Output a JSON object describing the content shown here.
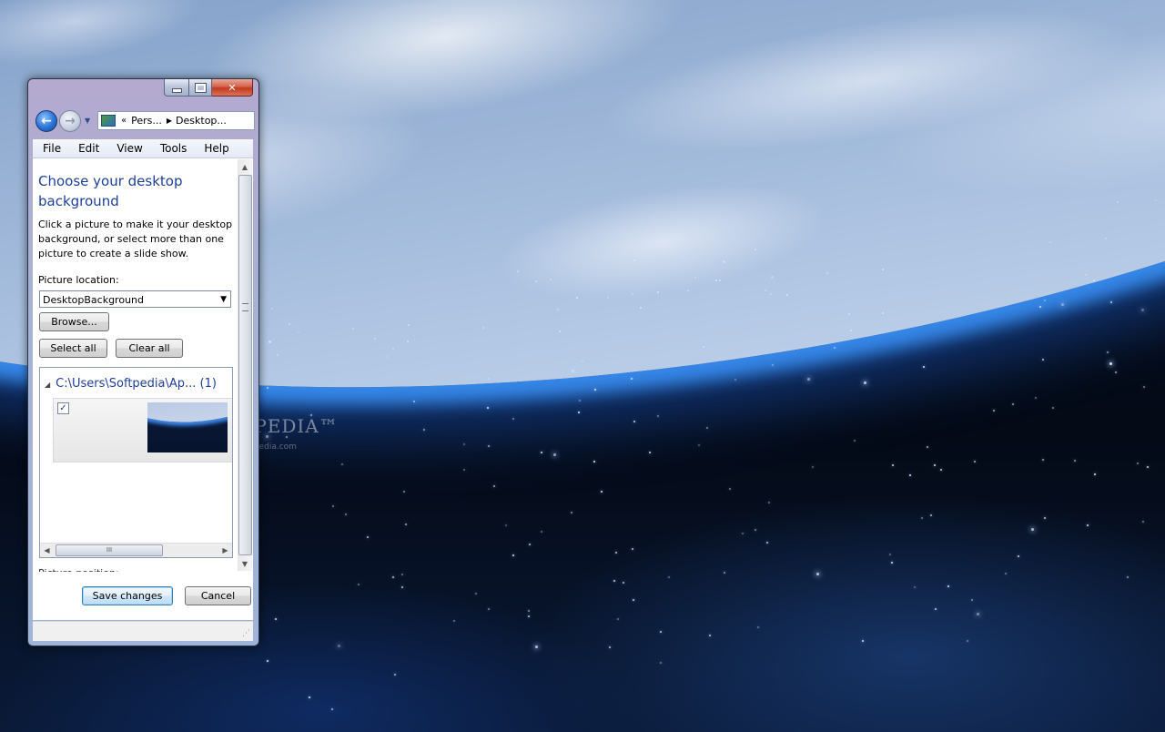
{
  "window": {
    "address_segments": [
      "Pers...",
      "Desktop..."
    ],
    "address_chevron": "«"
  },
  "menu": [
    "File",
    "Edit",
    "View",
    "Tools",
    "Help"
  ],
  "content": {
    "heading": "Choose your desktop background",
    "description": "Click a picture to make it your desktop background, or select more than one picture to create a slide show.",
    "picture_location_label": "Picture location:",
    "picture_location_value": "DesktopBackground",
    "browse_label": "Browse...",
    "select_all_label": "Select all",
    "clear_all_label": "Clear all",
    "gallery": {
      "group_header": "C:\\Users\\Softpedia\\Ap... (1)",
      "item_checked": true,
      "hscroll_grip": "III"
    },
    "cut_off_label": "Picture position:"
  },
  "footer": {
    "save_label": "Save changes",
    "cancel_label": "Cancel"
  },
  "desktop": {
    "watermark": "SOFTPEDIA™",
    "watermark_url": "www.softpedia.com"
  },
  "icons": {
    "back": "back-arrow-icon",
    "forward": "forward-arrow-icon",
    "address": "control-panel-icon",
    "close": "close-icon",
    "minimize": "minimize-icon",
    "maximize": "maximize-icon"
  },
  "colors": {
    "heading_blue": "#1e3f9b",
    "close_red": "#c23a1e",
    "glow_blue": "#3c96ff"
  }
}
